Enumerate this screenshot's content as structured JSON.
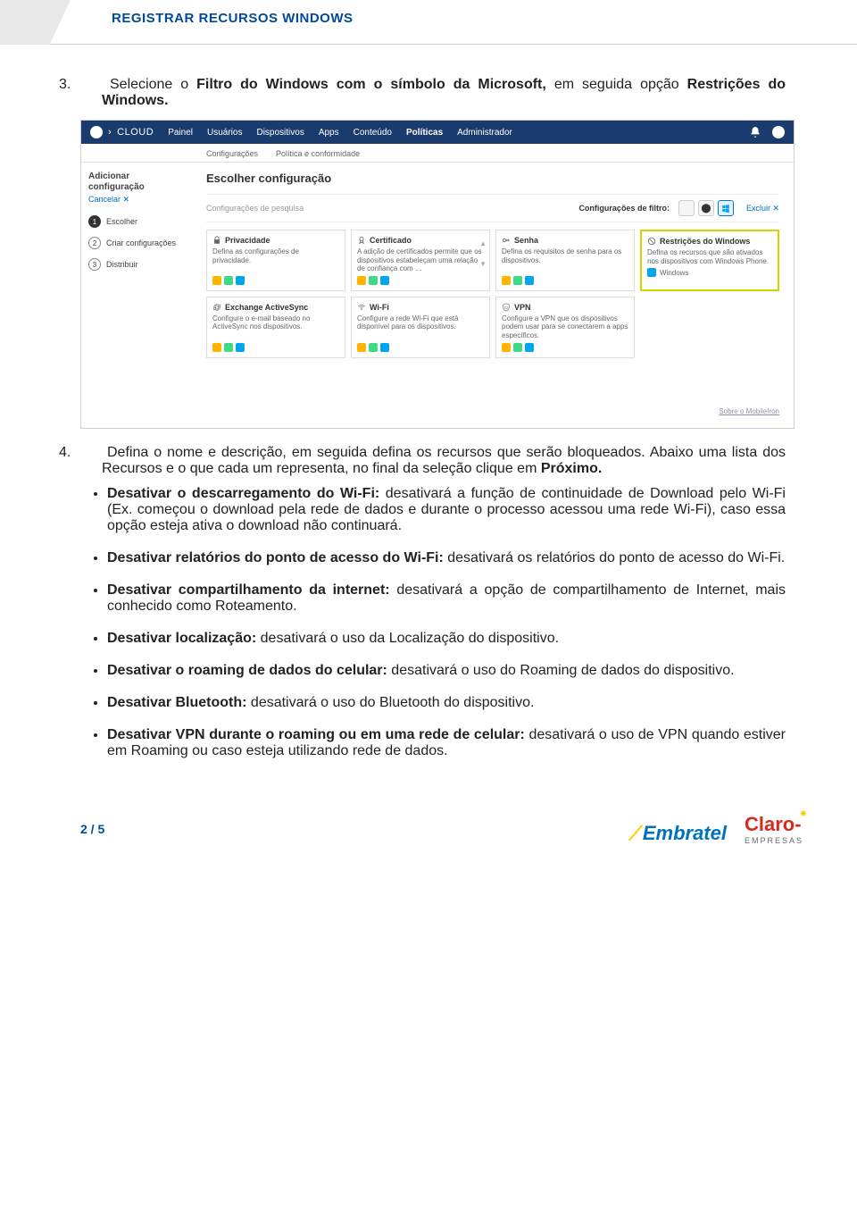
{
  "header": {
    "title": "REGISTRAR RECURSOS WINDOWS"
  },
  "step3": {
    "num": "3.",
    "text_before_bold1": "Selecione o ",
    "bold1": "Filtro do Windows com o símbolo da Microsoft,",
    "text_mid": " em seguida opção ",
    "bold2": "Restrições do Windows."
  },
  "shot": {
    "brand": "CLOUD",
    "nav": [
      "Painel",
      "Usuários",
      "Dispositivos",
      "Apps",
      "Conteúdo",
      "Políticas",
      "Administrador"
    ],
    "nav_active_index": 5,
    "subnav": [
      "Configurações",
      "Política e conformidade"
    ],
    "side": {
      "add_line1": "Adicionar",
      "add_line2": "configuração",
      "cancel": "Cancelar ✕",
      "steps": [
        {
          "n": "1",
          "label": "Escolher"
        },
        {
          "n": "2",
          "label": "Criar configurações"
        },
        {
          "n": "3",
          "label": "Distribuir"
        }
      ]
    },
    "main_title": "Escolher configuração",
    "search_placeholder": "Configurações de pesquisa",
    "filter_label": "Configurações de filtro:",
    "excluir": "Excluir ✕",
    "cards": [
      {
        "title": "Privacidade",
        "desc": "Defina as configurações de privacidade.",
        "icons": [
          "ios",
          "and",
          "win"
        ]
      },
      {
        "title": "Certificado",
        "desc": "A adição de certificados permite que os dispositivos estabeleçam uma relação de confiança com …",
        "icons": [
          "ios",
          "and",
          "win"
        ],
        "scroll": true
      },
      {
        "title": "Senha",
        "desc": "Defina os requisitos de senha para os dispositivos.",
        "icons": [
          "ios",
          "and",
          "win"
        ]
      },
      {
        "title": "Restrições do Windows",
        "desc": "Defina os recursos que são ativados nos dispositivos com Windows Phone.",
        "win_only": "Windows",
        "hl": true
      },
      {
        "title": "Exchange ActiveSync",
        "desc": "Configure o e-mail baseado no ActiveSync nos dispositivos.",
        "icons": [
          "ios",
          "and",
          "win"
        ]
      },
      {
        "title": "Wi-Fi",
        "desc": "Configure a rede Wi-Fi que está disponível para os dispositivos.",
        "icons": [
          "ios",
          "and",
          "win"
        ]
      },
      {
        "title": "VPN",
        "desc": "Configure a VPN que os dispositivos podem usar para se conectarem a apps específicos.",
        "icons": [
          "ios",
          "and",
          "win"
        ]
      }
    ],
    "footer_link": "Sobre o MobileIron"
  },
  "step4": {
    "num": "4.",
    "line1": "Defina o nome e descrição, em seguida defina os recursos que serão bloqueados. Abaixo uma lista dos Recursos e o que cada um representa, no final da seleção clique em ",
    "bold": "Próximo."
  },
  "bullets": [
    {
      "b": "Desativar o descarregamento do Wi-Fi:",
      "t": " desativará a função de continuidade de Download pelo Wi-Fi (Ex. começou o download pela rede de dados e durante o processo acessou uma rede Wi-Fi), caso essa opção esteja ativa o download não continuará."
    },
    {
      "b": "Desativar relatórios do ponto de acesso do Wi-Fi:",
      "t": " desativará os relatórios do ponto de acesso do Wi-Fi."
    },
    {
      "b": "Desativar compartilhamento da internet:",
      "t": " desativará a opção de compartilhamento de Internet, mais conhecido como Roteamento."
    },
    {
      "b": "Desativar localização:",
      "t": " desativará o uso da Localização do dispositivo."
    },
    {
      "b": "Desativar o roaming de dados do celular:",
      "t": " desativará o uso do Roaming de dados do dispositivo."
    },
    {
      "b": "Desativar Bluetooth:",
      "t": " desativará o uso do Bluetooth do dispositivo."
    },
    {
      "b": "Desativar VPN durante o roaming ou em uma rede de celular:",
      "t": " desativará o uso de VPN quando estiver em Roaming ou caso esteja utilizando rede de dados."
    }
  ],
  "footer": {
    "pager": "2 / 5",
    "logo1": "Embratel",
    "logo2": "Claro",
    "logo2_sub": "EMPRESAS"
  }
}
